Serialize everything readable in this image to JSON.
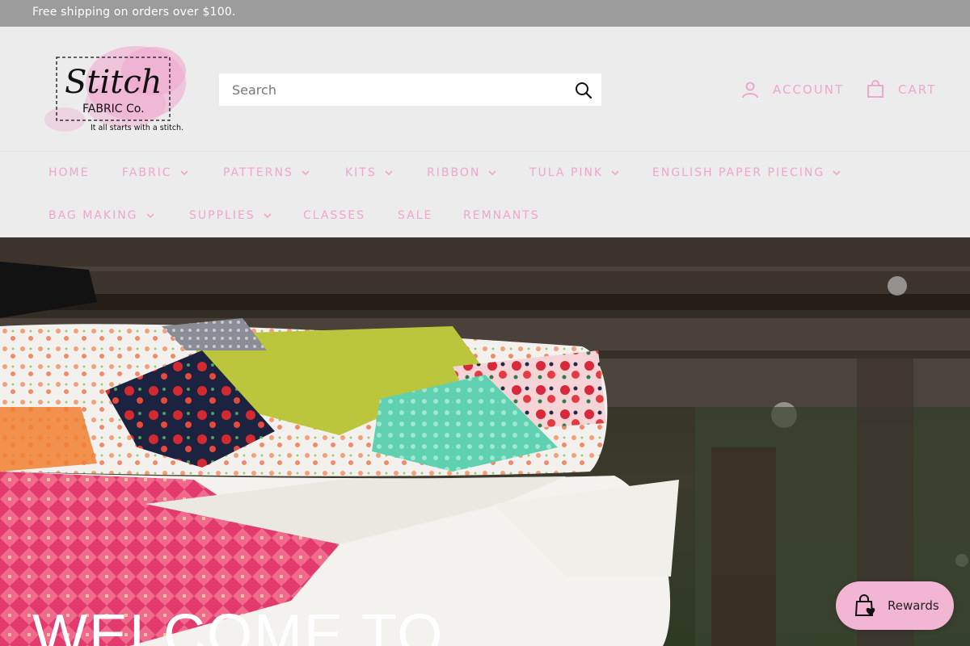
{
  "announcement": {
    "text": "Free shipping on orders over $100."
  },
  "header": {
    "logo": {
      "script_text": "Stitch",
      "sub_text": "Fabric Co.",
      "tagline": "It all starts with a stitch.",
      "color": "#f0a6cd"
    },
    "search": {
      "placeholder": "Search"
    },
    "account_label": "ACCOUNT",
    "cart_label": "CART",
    "accent_color": "#f0a6cd"
  },
  "nav": {
    "items": [
      {
        "label": "HOME",
        "dropdown": false
      },
      {
        "label": "FABRIC",
        "dropdown": true
      },
      {
        "label": "PATTERNS",
        "dropdown": true
      },
      {
        "label": "KITS",
        "dropdown": true
      },
      {
        "label": "RIBBON",
        "dropdown": true
      },
      {
        "label": "TULA PINK",
        "dropdown": true
      },
      {
        "label": "ENGLISH PAPER PIECING",
        "dropdown": true
      },
      {
        "label": "BAG MAKING",
        "dropdown": true
      },
      {
        "label": "SUPPLIES",
        "dropdown": true
      },
      {
        "label": "CLASSES",
        "dropdown": false
      },
      {
        "label": "SALE",
        "dropdown": false
      },
      {
        "label": "REMNANTS",
        "dropdown": false
      }
    ]
  },
  "hero": {
    "title": "WELCOME TO"
  },
  "rewards": {
    "label": "Rewards"
  }
}
